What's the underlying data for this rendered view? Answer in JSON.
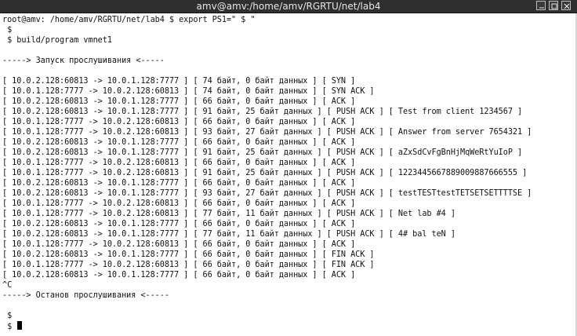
{
  "window": {
    "title": "amv@amv:/home/amv/RGRTU/net/lab4",
    "controls": {
      "minimize": "minimize-icon",
      "maximize": "maximize-icon",
      "close": "close-icon"
    }
  },
  "terminal": {
    "lines": [
      "root@amv: /home/amv/RGRTU/net/lab4 $ export PS1=\" $ \"",
      " $",
      " $ build/program vmnet1",
      "",
      "-----> Запуск прослушивания <-----",
      "",
      "[ 10.0.2.128:60813 -> 10.0.1.128:7777 ] [ 74 байт, 0 байт данных ] [ SYN ]",
      "[ 10.0.1.128:7777 -> 10.0.2.128:60813 ] [ 74 байт, 0 байт данных ] [ SYN ACK ]",
      "[ 10.0.2.128:60813 -> 10.0.1.128:7777 ] [ 66 байт, 0 байт данных ] [ ACK ]",
      "[ 10.0.2.128:60813 -> 10.0.1.128:7777 ] [ 91 байт, 25 байт данных ] [ PUSH ACK ] [ Test from client 1234567 ]",
      "[ 10.0.1.128:7777 -> 10.0.2.128:60813 ] [ 66 байт, 0 байт данных ] [ ACK ]",
      "[ 10.0.1.128:7777 -> 10.0.2.128:60813 ] [ 93 байт, 27 байт данных ] [ PUSH ACK ] [ Answer from server 7654321 ]",
      "[ 10.0.2.128:60813 -> 10.0.1.128:7777 ] [ 66 байт, 0 байт данных ] [ ACK ]",
      "[ 10.0.2.128:60813 -> 10.0.1.128:7777 ] [ 91 байт, 25 байт данных ] [ PUSH ACK ] [ aZxSdCvFgBnHjMqWeRtYuIoP ]",
      "[ 10.0.1.128:7777 -> 10.0.2.128:60813 ] [ 66 байт, 0 байт данных ] [ ACK ]",
      "[ 10.0.1.128:7777 -> 10.0.2.128:60813 ] [ 91 байт, 25 байт данных ] [ PUSH ACK ] [ 1223445667889009887666555 ]",
      "[ 10.0.2.128:60813 -> 10.0.1.128:7777 ] [ 66 байт, 0 байт данных ] [ ACK ]",
      "[ 10.0.2.128:60813 -> 10.0.1.128:7777 ] [ 93 байт, 27 байт данных ] [ PUSH ACK ] [ testTESTtestTETSETSETTTTSE ]",
      "[ 10.0.1.128:7777 -> 10.0.2.128:60813 ] [ 66 байт, 0 байт данных ] [ ACK ]",
      "[ 10.0.1.128:7777 -> 10.0.2.128:60813 ] [ 77 байт, 11 байт данных ] [ PUSH ACK ] [ Net lab #4 ]",
      "[ 10.0.2.128:60813 -> 10.0.1.128:7777 ] [ 66 байт, 0 байт данных ] [ ACK ]",
      "[ 10.0.2.128:60813 -> 10.0.1.128:7777 ] [ 77 байт, 11 байт данных ] [ PUSH ACK ] [ 4# bal teN ]",
      "[ 10.0.1.128:7777 -> 10.0.2.128:60813 ] [ 66 байт, 0 байт данных ] [ ACK ]",
      "[ 10.0.2.128:60813 -> 10.0.1.128:7777 ] [ 66 байт, 0 байт данных ] [ FIN ACK ]",
      "[ 10.0.1.128:7777 -> 10.0.2.128:60813 ] [ 66 байт, 0 байт данных ] [ FIN ACK ]",
      "[ 10.0.2.128:60813 -> 10.0.1.128:7777 ] [ 66 байт, 0 байт данных ] [ ACK ]",
      "^C",
      "-----> Останов прослушивания <-----",
      "",
      " $",
      " $ "
    ],
    "cursor_line_index": 30
  }
}
